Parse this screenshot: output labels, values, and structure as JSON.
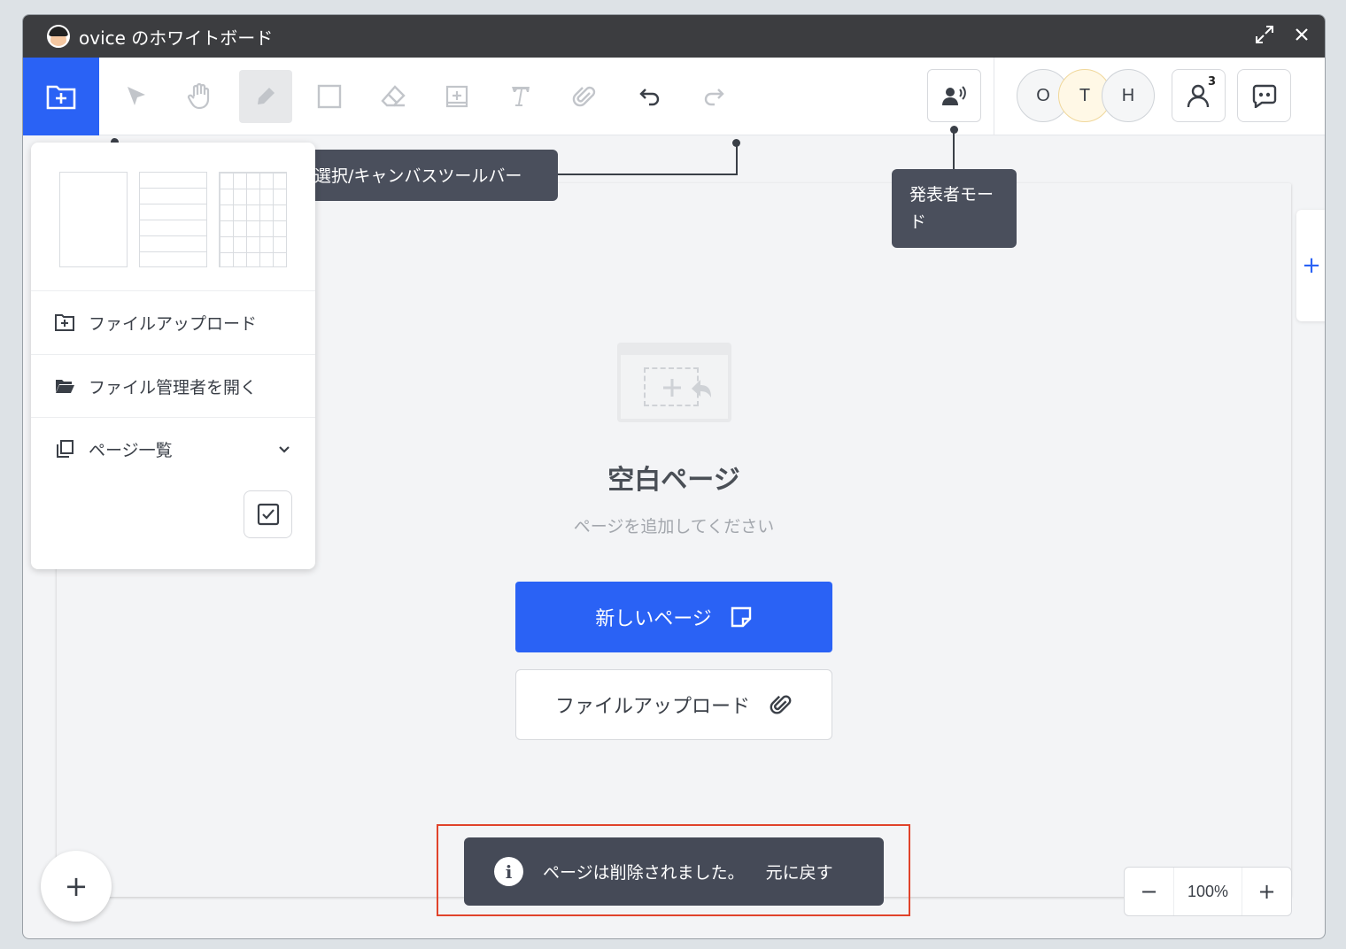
{
  "window": {
    "title": "ovice のホワイトボード"
  },
  "toolbar": {
    "tools": [
      "file-icon",
      "cursor-icon",
      "hand-icon",
      "pen-icon",
      "rectangle-icon",
      "eraser-icon",
      "add-card-icon",
      "text-icon",
      "attachment-icon",
      "undo-icon",
      "redo-icon"
    ]
  },
  "avatars": [
    "O",
    "T",
    "H"
  ],
  "participants_count": "3",
  "tooltips": {
    "canvas_toolbar": "選択/キャンバスツールバー",
    "presenter_mode": "発表者モード"
  },
  "file_menu": {
    "items": [
      {
        "label": "ファイルアップロード"
      },
      {
        "label": "ファイル管理者を開く"
      },
      {
        "label": "ページ一覧"
      }
    ]
  },
  "empty_state": {
    "title": "空白ページ",
    "subtitle": "ページを追加してください",
    "primary_button": "新しいページ",
    "secondary_button": "ファイルアップロード"
  },
  "toast": {
    "message": "ページは削除されました。",
    "action": "元に戻す"
  },
  "zoom": {
    "minus": "−",
    "value": "100%",
    "plus": "+"
  },
  "side_add": "+",
  "fab": "+",
  "colors": {
    "accent": "#2a62f5",
    "titlebar": "#3c3d40",
    "toast": "#454a57",
    "highlight": "#e0432b"
  }
}
